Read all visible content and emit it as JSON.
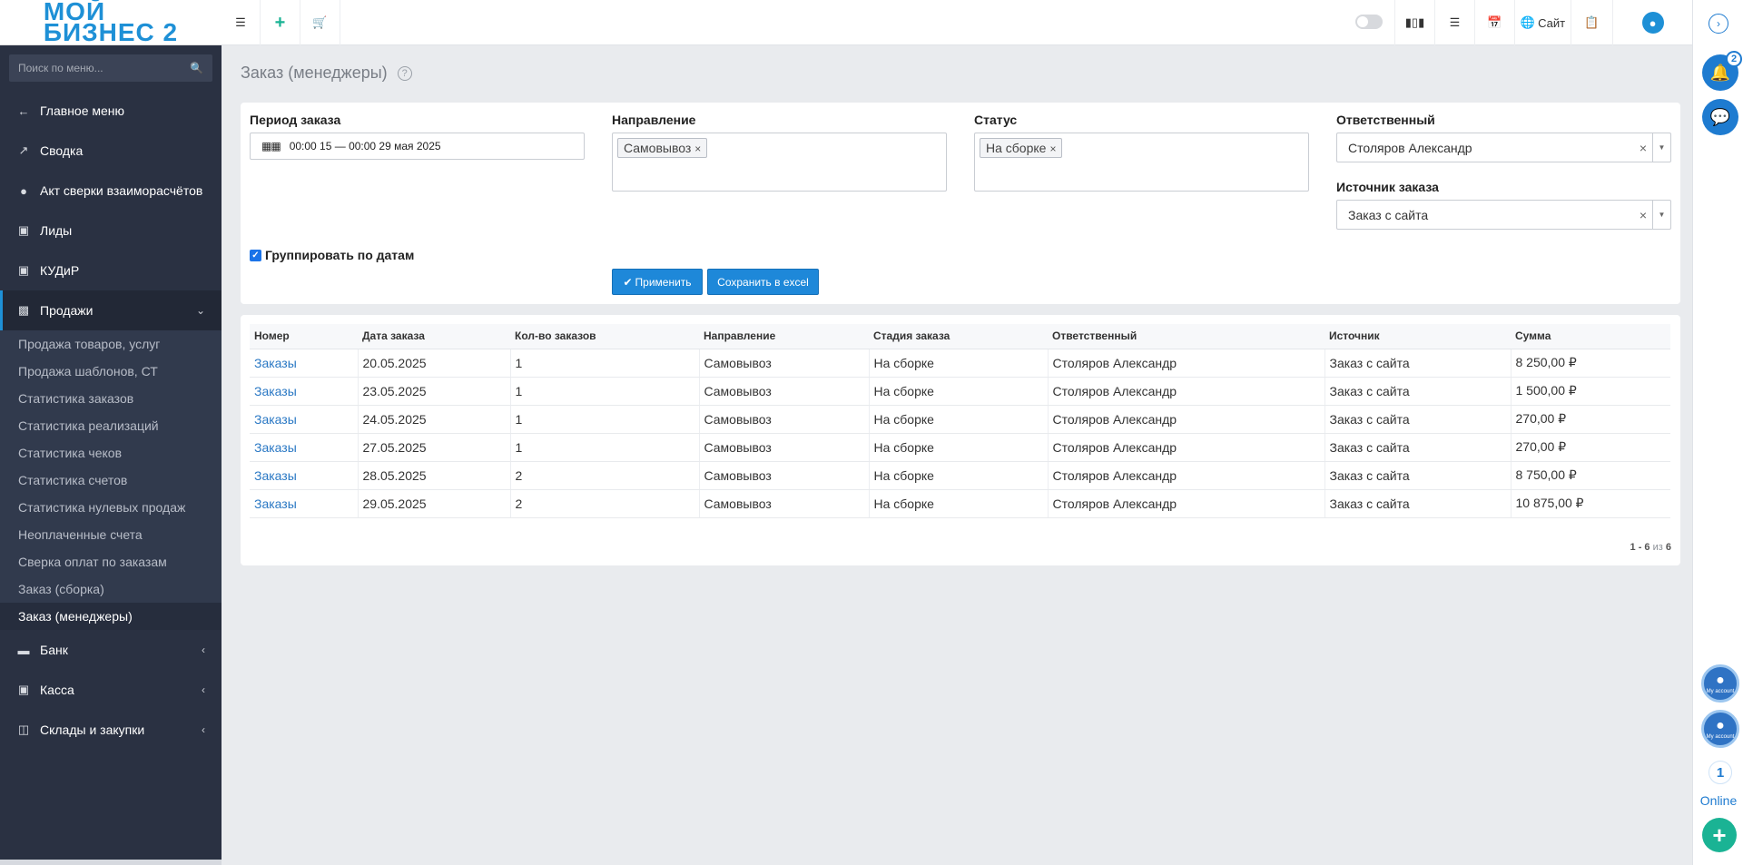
{
  "logo": {
    "line1": "МОЙ",
    "line2": "БИЗНЕС 2"
  },
  "sidebar": {
    "search_placeholder": "Поиск по меню...",
    "items": [
      {
        "label": "Главное меню",
        "icon": "arrow-left-icon"
      },
      {
        "label": "Сводка",
        "icon": "chart-line-icon"
      },
      {
        "label": "Акт сверки взаиморасчётов",
        "icon": "users-icon"
      },
      {
        "label": "Лиды",
        "icon": "contact-card-icon"
      },
      {
        "label": "КУДиР",
        "icon": "contact-card-icon"
      },
      {
        "label": "Продажи",
        "icon": "bar-chart-icon"
      },
      {
        "label": "Банк",
        "icon": "credit-card-icon"
      },
      {
        "label": "Касса",
        "icon": "cash-icon"
      },
      {
        "label": "Склады и закупки",
        "icon": "box-icon"
      }
    ],
    "sales_submenu": [
      "Продажа товаров, услуг",
      "Продажа шаблонов, СТ",
      "Статистика заказов",
      "Статистика реализаций",
      "Статистика чеков",
      "Статистика счетов",
      "Статистика нулевых продаж",
      "Неоплаченные счета",
      "Сверка оплат по заказам",
      "Заказ (сборка)",
      "Заказ (менеджеры)"
    ]
  },
  "topbar": {
    "site_label": "Сайт"
  },
  "rightrail": {
    "notifications_count": "2",
    "account_label": "My account",
    "online_count": "1",
    "online_label": "Online"
  },
  "page": {
    "title": "Заказ (менеджеры)",
    "help": "?"
  },
  "filters": {
    "period_label": "Период заказа",
    "period_value": "00:00 15 — 00:00 29 мая 2025",
    "direction_label": "Направление",
    "direction_tags": [
      "Самовывоз"
    ],
    "status_label": "Статус",
    "status_tags": [
      "На сборке"
    ],
    "responsible_label": "Ответственный",
    "responsible_value": "Столяров Александр",
    "source_label": "Источник заказа",
    "source_value": "Заказ с сайта",
    "group_by_dates_label": "Группировать по датам",
    "apply_label": "Применить",
    "excel_label": "Сохранить в excel"
  },
  "table": {
    "headers": [
      "Номер",
      "Дата заказа",
      "Кол-во заказов",
      "Направление",
      "Стадия заказа",
      "Ответственный",
      "Источник",
      "Сумма"
    ],
    "rows": [
      [
        "Заказы",
        "20.05.2025",
        "1",
        "Самовывоз",
        "На сборке",
        "Столяров Александр",
        "Заказ с сайта",
        "8 250,00 ₽"
      ],
      [
        "Заказы",
        "23.05.2025",
        "1",
        "Самовывоз",
        "На сборке",
        "Столяров Александр",
        "Заказ с сайта",
        "1 500,00 ₽"
      ],
      [
        "Заказы",
        "24.05.2025",
        "1",
        "Самовывоз",
        "На сборке",
        "Столяров Александр",
        "Заказ с сайта",
        "270,00 ₽"
      ],
      [
        "Заказы",
        "27.05.2025",
        "1",
        "Самовывоз",
        "На сборке",
        "Столяров Александр",
        "Заказ с сайта",
        "270,00 ₽"
      ],
      [
        "Заказы",
        "28.05.2025",
        "2",
        "Самовывоз",
        "На сборке",
        "Столяров Александр",
        "Заказ с сайта",
        "8 750,00 ₽"
      ],
      [
        "Заказы",
        "29.05.2025",
        "2",
        "Самовывоз",
        "На сборке",
        "Столяров Александр",
        "Заказ с сайта",
        "10 875,00 ₽"
      ]
    ],
    "pager": {
      "range": "1 - 6",
      "of_label": "из",
      "total": "6"
    }
  }
}
